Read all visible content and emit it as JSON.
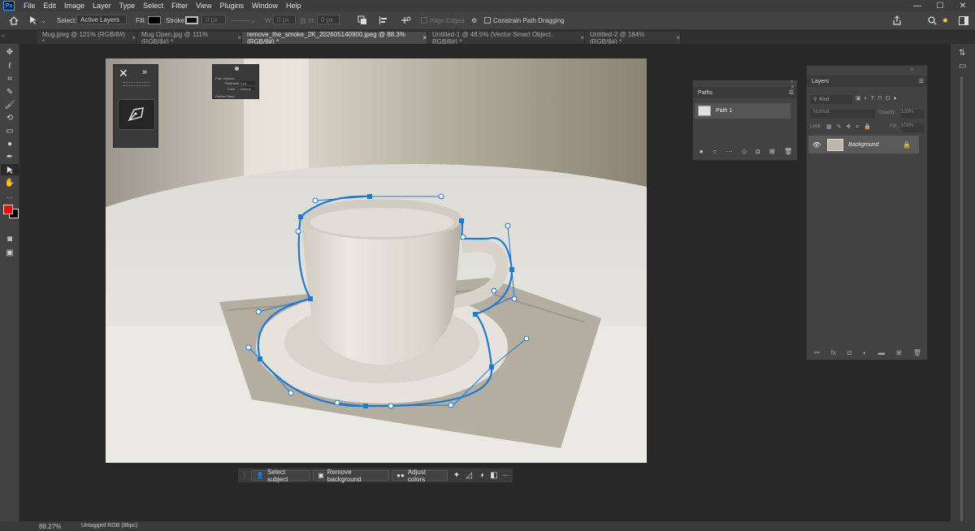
{
  "app": {
    "logo": "Ps"
  },
  "menu": [
    "File",
    "Edit",
    "Image",
    "Layer",
    "Type",
    "Select",
    "Filter",
    "View",
    "Plugins",
    "Window",
    "Help"
  ],
  "window_controls": {
    "minimize": "—",
    "maximize": "☐",
    "close": "✕"
  },
  "options_bar": {
    "select_label": "Select:",
    "select_value": "Active Layers",
    "fill_label": "Fill:",
    "stroke_label": "Stroke:",
    "stroke_size": "0 px",
    "w_label": "W:",
    "w_value": "0 px",
    "h_label": "H:",
    "h_value": "0 px",
    "align_edges": "Align Edges",
    "constrain_path": "Constrain Path Dragging"
  },
  "tabs": [
    {
      "label": "Mug.jpeg @ 121% (RGB/8#) *",
      "active": false
    },
    {
      "label": "Mug Open.jpg @ 111% (RGB/8#) *",
      "active": false
    },
    {
      "label": "remove_the_smoke_2K_202605140900.jpeg @ 88.3% (RGB/8#) *",
      "active": true
    },
    {
      "label": "Untitled-1 @ 48.5% (Vector Smart Object, RGB/8#) *",
      "active": false
    },
    {
      "label": "Untitled-2 @ 184% (RGB/8#) *",
      "active": false
    }
  ],
  "tab_close": "×",
  "colors": {
    "foreground": "#ff0000",
    "background": "#000000",
    "path_stroke": "#1f78d1",
    "accent": "#31a8ff"
  },
  "path_options": {
    "title": "Path Options",
    "thickness_label": "Thickness",
    "thickness_value": "1 px",
    "color_label": "Color",
    "color_value": "Default",
    "rubber_band": "Rubber Band"
  },
  "paths_panel": {
    "title": "Paths",
    "items": [
      {
        "label": "Path 1"
      }
    ]
  },
  "layers_panel": {
    "title": "Layers",
    "kind": "Kind",
    "blend_mode": "Normal",
    "opacity_label": "Opacity:",
    "opacity_value": "100%",
    "lock_label": "Lock:",
    "fill_label": "Fill:",
    "fill_value": "100%",
    "layers": [
      {
        "name": "Background",
        "visible": true,
        "locked": true
      }
    ]
  },
  "taskbar": {
    "select_subject": "Select subject",
    "remove_background": "Remove background",
    "adjust_colors": "Adjust colors",
    "more": "···"
  },
  "status": {
    "zoom": "88.27%",
    "profile": "Untagged RGB (8bpc)"
  }
}
